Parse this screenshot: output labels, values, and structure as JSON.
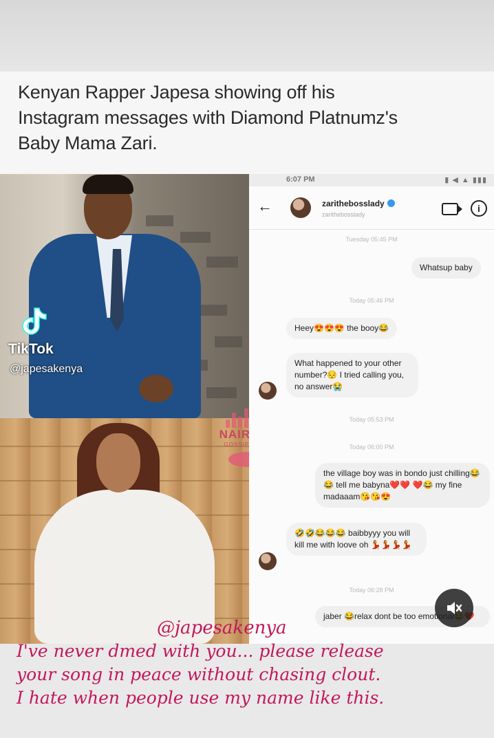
{
  "post": {
    "headline_line1": "Kenyan Rapper Japesa showing off his",
    "headline_line2": "Instagram messages with Diamond Platnumz's",
    "headline_line3": "Baby Mama Zari."
  },
  "tiktok": {
    "logo_icon": "tiktok-logo-icon",
    "name": "TikTok",
    "handle": "@japesakenya"
  },
  "watermark": {
    "name": "NAIROBI",
    "sub": "GOSSIP CLUB",
    "icon": "lips-icon"
  },
  "chat": {
    "status_time": "6:07 PM",
    "status_right": "▮ ◀ ▲ ▮▮▮",
    "contact_name": "zarithebosslady",
    "contact_handle": "zarithebosslady",
    "messages": [
      {
        "type": "timestamp",
        "text": "Tuesday 05:45 PM"
      },
      {
        "type": "outgoing",
        "text": "Whatsup baby"
      },
      {
        "type": "timestamp",
        "text": "Today 05:46 PM"
      },
      {
        "type": "incoming",
        "text": "Heey😍😍😍 the booy😂"
      },
      {
        "type": "incoming",
        "text": "What happened to your other number?😔 I tried calling you, no answer😭"
      },
      {
        "type": "timestamp",
        "text": "Today 05:53 PM"
      },
      {
        "type": "timestamp",
        "text": "Today 06:00 PM"
      },
      {
        "type": "outgoing",
        "text": "the village boy was in bondo just chilling😂😂 tell me babyna❤️❤️ ❤️😂 my fine madaaam😘😘😍"
      },
      {
        "type": "incoming",
        "text": "🤣🤣😂😂😂 baibbyyy you will kill me with loove oh 💃💃💃💃"
      },
      {
        "type": "timestamp",
        "text": "Today 06:28 PM"
      },
      {
        "type": "outgoing",
        "text": "jaber 😂relax dont be too emotional😂❤️"
      }
    ]
  },
  "video_controls": {
    "mute_icon": "speaker-muted-icon"
  },
  "overlay": {
    "handle": "@japesakenya",
    "caption_line1": "I've never dmed with you... please release",
    "caption_line2": "your song in peace without chasing clout.",
    "caption_line3": "I hate when people use my name like this."
  },
  "colors": {
    "caption": "#c2185b",
    "verified": "#3897f0",
    "suit": "#1f4f86"
  }
}
